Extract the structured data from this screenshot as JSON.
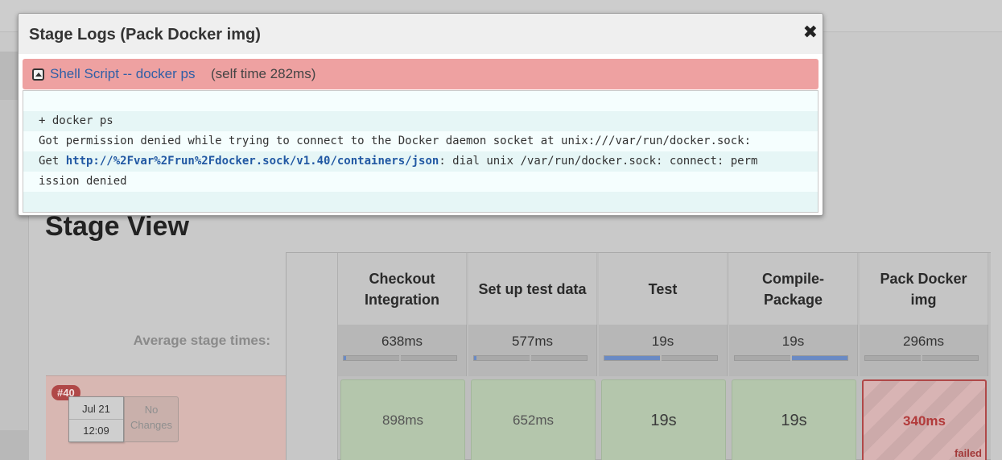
{
  "modal": {
    "title": "Stage Logs (Pack Docker img)",
    "close_label": "✖",
    "step": {
      "name": "Shell Script -- docker ps",
      "self_time": "(self time 282ms)"
    },
    "log": {
      "line1": "+ docker ps",
      "line2": "Got permission denied while trying to connect to the Docker daemon socket at unix:///var/run/docker.sock:",
      "line3_prefix": "Get ",
      "line3_link": "http://%2Fvar%2Frun%2Fdocker.sock/v1.40/containers/json",
      "line3_suffix": ": dial unix /var/run/docker.sock: connect: perm",
      "line4": "ission denied"
    }
  },
  "stage_view": {
    "title": "Stage View",
    "average_label": "Average stage times:",
    "stages": [
      {
        "name": "Checkout Integration",
        "avg": "638ms",
        "bar_start": 0.0,
        "bar_fill": 0.02
      },
      {
        "name": "Set up test data",
        "avg": "577ms",
        "bar_start": 0.0,
        "bar_fill": 0.02
      },
      {
        "name": "Test",
        "avg": "19s",
        "bar_start": 0.0,
        "bar_fill": 0.49
      },
      {
        "name": "Compile-Package",
        "avg": "19s",
        "bar_start": 0.5,
        "bar_fill": 0.5
      },
      {
        "name": "Pack Docker img",
        "avg": "296ms",
        "bar_start": 0.0,
        "bar_fill": 0.0
      }
    ],
    "run": {
      "badge": "#40",
      "date": "Jul 21",
      "time": "12:09",
      "changes": "No Changes",
      "cells": [
        {
          "value": "898ms",
          "status": "success"
        },
        {
          "value": "652ms",
          "status": "success"
        },
        {
          "value": "19s",
          "status": "success"
        },
        {
          "value": "19s",
          "status": "success"
        },
        {
          "value": "340ms",
          "status": "failed",
          "status_label": "failed"
        }
      ]
    }
  },
  "colors": {
    "failed": "#b04848",
    "success_cell": "#b4c6ac",
    "step_bar": "#eea1a1",
    "link": "#2f5fa6",
    "progress_fill": "#6a8ac4"
  }
}
